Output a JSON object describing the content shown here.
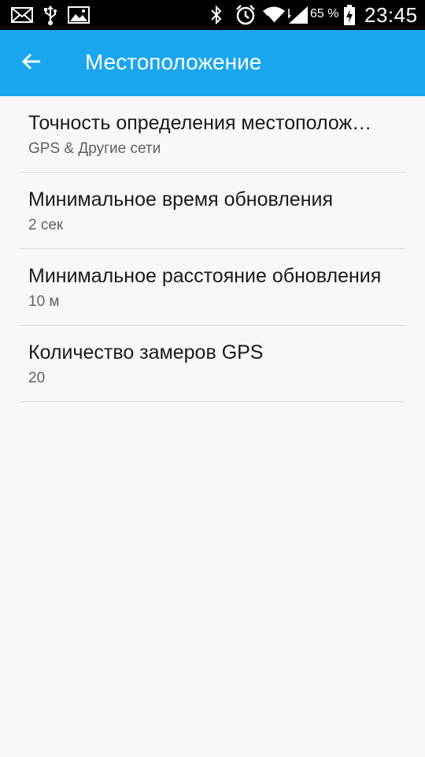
{
  "status_bar": {
    "battery_percent": "65 %",
    "time": "23:45",
    "icons": [
      "mail-icon",
      "usb-icon",
      "image-icon",
      "bluetooth-icon",
      "alarm-icon",
      "wifi-icon",
      "signal-icon",
      "battery-charging-icon"
    ]
  },
  "app_bar": {
    "back_icon": "arrow-left-icon",
    "title": "Местоположение",
    "background": "#1aa6ef"
  },
  "settings": [
    {
      "title": "Точность определения местоположения",
      "summary": "GPS & Другие сети"
    },
    {
      "title": "Минимальное время обновления",
      "summary": "2 сек"
    },
    {
      "title": "Минимальное расстояние обновления",
      "summary": "10 м"
    },
    {
      "title": "Количество замеров GPS",
      "summary": "20"
    }
  ]
}
